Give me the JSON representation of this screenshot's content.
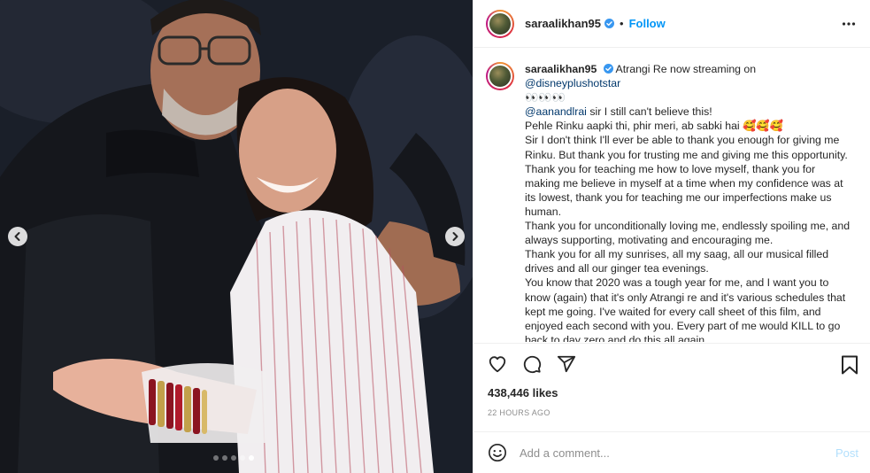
{
  "post": {
    "username": "saraalikhan95",
    "follow_separator": "•",
    "follow_label": "Follow"
  },
  "caption": {
    "username": "saraalikhan95",
    "first_line": "Atrangi Re now streaming on",
    "first_mention": "@disneyplushotstar",
    "emoji_line": "👀👀👀",
    "second_mention": "@aanandlrai",
    "line_after_mention": "sir I still can't believe this!",
    "paragraphs": [
      "Pehle Rinku aapki thi, phir meri, ab sabki hai 🥰🥰🥰",
      "Sir I don't think I'll ever be able to thank you enough for giving me Rinku. But thank you for trusting me and giving me this opportunity. Thank you for teaching me how to love myself, thank you for making me believe in myself at a time when my confidence was at its lowest, thank you for teaching me our imperfections make us human.",
      "Thank you for unconditionally loving me, endlessly spoiling me, and always supporting, motivating and encouraging me.",
      "Thank you for all my sunrises, all my saag, all our musical filled drives and all our ginger tea evenings.",
      "You know that 2020 was a tough year for me, and I want you to know (again) that it's only Atrangi re and it's various schedules that kept me going. I've waited for every call sheet of this film, and enjoyed each second with you. Every part of me would KILL to go back to day zero and do this all again."
    ]
  },
  "stats": {
    "likes": "438,446 likes",
    "timestamp": "22 HOURS AGO"
  },
  "comment": {
    "placeholder": "Add a comment...",
    "post_label": "Post"
  },
  "carousel": {
    "slide_count": 5,
    "active_index": 4
  },
  "colors": {
    "accent": "#0095f6",
    "mention": "#00376b",
    "post_disabled": "#b2dffc",
    "muted": "#8e8e8e"
  },
  "icons": [
    "verified-badge-icon",
    "more-options-icon",
    "heart-icon",
    "comment-icon",
    "share-icon",
    "bookmark-icon",
    "emoji-icon",
    "chevron-left-icon",
    "chevron-right-icon"
  ]
}
